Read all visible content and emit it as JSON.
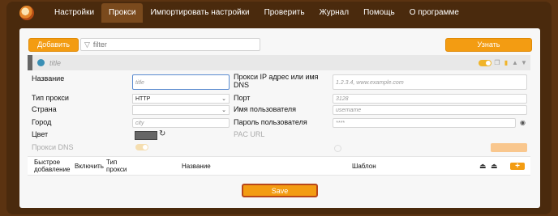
{
  "nav": {
    "items": [
      {
        "label": "Настройки"
      },
      {
        "label": "Прокси"
      },
      {
        "label": "Импортировать настройки"
      },
      {
        "label": "Проверить"
      },
      {
        "label": "Журнал"
      },
      {
        "label": "Помощь"
      },
      {
        "label": "О программе"
      }
    ],
    "active": "Прокси"
  },
  "toolbar": {
    "add_label": "Добавить",
    "filter_placeholder": "filter",
    "locate_label": "Узнать местонахождение"
  },
  "proxy": {
    "title_placeholder": "title",
    "enabled": true,
    "fields": {
      "name_label": "Название",
      "name_placeholder": "title",
      "type_label": "Тип прокси",
      "type_value": "HTTP",
      "country_label": "Страна",
      "country_value": "",
      "city_label": "Город",
      "city_placeholder": "city",
      "color_label": "Цвет",
      "color_value": "#666666",
      "dns_label": "Прокси DNS",
      "host_label": "Прокси IP адрес или имя DNS",
      "host_placeholder": "1.2.3.4, www.example.com",
      "port_label": "Порт",
      "port_placeholder": "3128",
      "user_label": "Имя пользователя",
      "user_placeholder": "username",
      "pass_label": "Пароль пользователя",
      "pass_placeholder": "****",
      "pac_label": "PAC URL"
    }
  },
  "table": {
    "headers": {
      "quick_add": "Быстрое добавление",
      "enable": "Включить",
      "type": "Тип прокси",
      "name": "Название",
      "pattern": "Шаблон"
    },
    "add_symbol": "+"
  },
  "save_label": "Save"
}
